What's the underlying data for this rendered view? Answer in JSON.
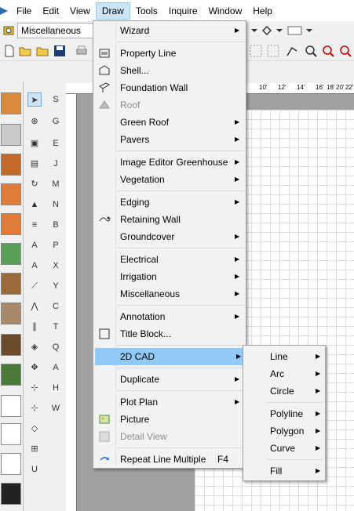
{
  "menubar": {
    "items": [
      {
        "label": "File",
        "u": "F"
      },
      {
        "label": "Edit",
        "u": "E"
      },
      {
        "label": "View",
        "u": "V"
      },
      {
        "label": "Draw",
        "u": "D"
      },
      {
        "label": "Tools",
        "u": "T"
      },
      {
        "label": "Inquire",
        "u": "I"
      },
      {
        "label": "Window",
        "u": "W"
      },
      {
        "label": "Help",
        "u": "H"
      }
    ],
    "active": "Draw"
  },
  "toolbar": {
    "layer_combo_value": "Miscellaneous"
  },
  "ruler": {
    "ticks": [
      "10'",
      "12'",
      "14'",
      "16'",
      "18'",
      "20'",
      "22'"
    ]
  },
  "draw_menu": {
    "items": [
      {
        "label": "Wizard",
        "submenu": true
      },
      {
        "separator": true
      },
      {
        "label": "Property Line",
        "icon": "property-line-icon"
      },
      {
        "label": "Shell...",
        "icon": "shell-icon"
      },
      {
        "label": "Foundation Wall",
        "icon": "foundation-wall-icon"
      },
      {
        "label": "Roof",
        "icon": "roof-icon",
        "disabled": true
      },
      {
        "label": "Green Roof",
        "submenu": true
      },
      {
        "label": "Pavers",
        "submenu": true
      },
      {
        "separator": true
      },
      {
        "label": "Image Editor Greenhouse",
        "submenu": true
      },
      {
        "label": "Vegetation",
        "submenu": true
      },
      {
        "separator": true
      },
      {
        "label": "Edging",
        "submenu": true
      },
      {
        "label": "Retaining Wall",
        "icon": "retaining-wall-icon"
      },
      {
        "label": "Groundcover",
        "submenu": true
      },
      {
        "separator": true
      },
      {
        "label": "Electrical",
        "submenu": true
      },
      {
        "label": "Irrigation",
        "submenu": true
      },
      {
        "label": "Miscellaneous",
        "submenu": true
      },
      {
        "separator": true
      },
      {
        "label": "Annotation",
        "submenu": true
      },
      {
        "label": "Title Block...",
        "icon": "title-block-icon"
      },
      {
        "separator": true
      },
      {
        "label": "2D CAD",
        "submenu": true,
        "highlighted": true
      },
      {
        "separator": true
      },
      {
        "label": "Duplicate",
        "submenu": true
      },
      {
        "separator": true
      },
      {
        "label": "Plot Plan",
        "submenu": true
      },
      {
        "label": "Picture",
        "icon": "picture-icon"
      },
      {
        "label": "Detail View",
        "icon": "detail-view-icon",
        "disabled": true
      },
      {
        "separator": true
      },
      {
        "label": "Repeat Line Multiple",
        "icon": "repeat-icon",
        "shortcut": "F4"
      }
    ]
  },
  "cad_submenu": {
    "items": [
      {
        "label": "Line",
        "submenu": true
      },
      {
        "label": "Arc",
        "submenu": true
      },
      {
        "label": "Circle",
        "submenu": true
      },
      {
        "separator": true
      },
      {
        "label": "Polyline",
        "submenu": true
      },
      {
        "label": "Polygon",
        "submenu": true
      },
      {
        "label": "Curve",
        "submenu": true
      },
      {
        "separator": true
      },
      {
        "label": "Fill",
        "submenu": true
      }
    ]
  },
  "colors": {
    "menu_bg": "#f2f2f2",
    "highlight": "#91c9f7",
    "menubar_active": "#cce4f7"
  }
}
